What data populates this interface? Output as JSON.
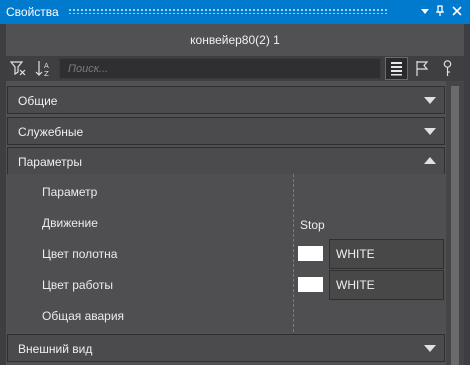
{
  "window": {
    "title": "Свойства"
  },
  "panel": {
    "object_name": "конвейер80(2) 1",
    "search_placeholder": "Поиск..."
  },
  "sections": [
    {
      "label": "Общие",
      "state": "collapsed"
    },
    {
      "label": "Служебные",
      "state": "collapsed"
    },
    {
      "label": "Параметры",
      "state": "expanded"
    },
    {
      "label": "Внешний вид",
      "state": "collapsed"
    }
  ],
  "properties": [
    {
      "name": "Параметр",
      "value": ""
    },
    {
      "name": "Движение",
      "value": "Stop"
    },
    {
      "name": "Цвет полотна",
      "value": "WHITE",
      "color": "#ffffff"
    },
    {
      "name": "Цвет работы",
      "value": "WHITE",
      "color": "#ffffff"
    },
    {
      "name": "Общая авария",
      "value": ""
    }
  ],
  "colors": {
    "accent": "#007acc",
    "panel": "#515153"
  }
}
